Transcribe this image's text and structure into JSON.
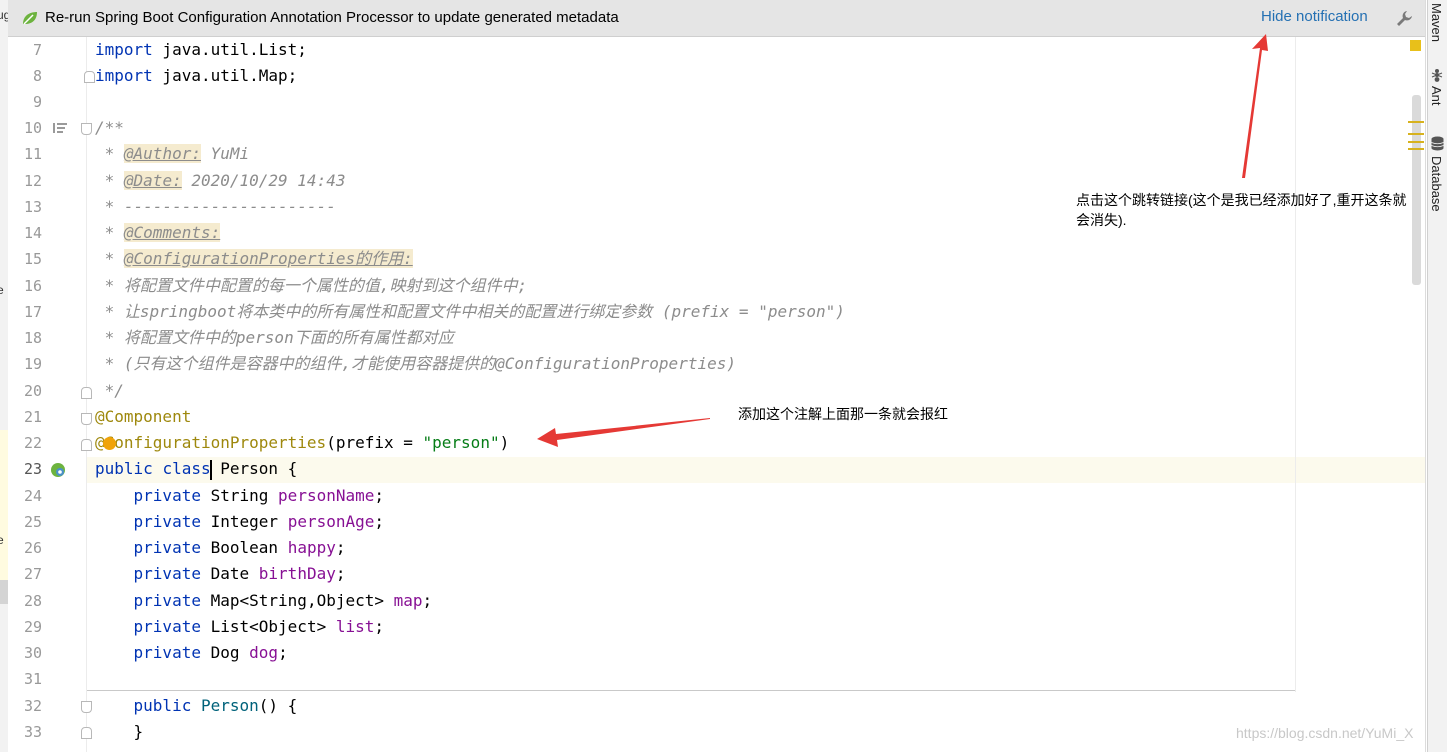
{
  "notification": {
    "message": "Re-run Spring Boot Configuration Annotation Processor to update generated metadata",
    "hide_link": "Hide notification"
  },
  "tool_windows": [
    "Maven",
    "Ant",
    "Database"
  ],
  "left_stub_chars": [
    "ug",
    "e",
    "e"
  ],
  "line_numbers": [
    "7",
    "8",
    "9",
    "10",
    "11",
    "12",
    "13",
    "14",
    "15",
    "16",
    "17",
    "18",
    "19",
    "20",
    "21",
    "22",
    "23",
    "24",
    "25",
    "26",
    "27",
    "28",
    "29",
    "30",
    "31",
    "32",
    "33"
  ],
  "code": {
    "l7": {
      "kw": "import",
      "rest": " java.util.List;"
    },
    "l8": {
      "kw": "import",
      "rest": " java.util.Map;"
    },
    "l10": "/**",
    "l11": {
      "pre": " * ",
      "tag": "@Author:",
      "post": " YuMi"
    },
    "l12": {
      "pre": " * ",
      "tag": "@Date:",
      "post": " 2020/10/29 14:43"
    },
    "l13": " * ----------------------",
    "l14": {
      "pre": " * ",
      "tag": "@Comments:"
    },
    "l15": {
      "pre": " * ",
      "tag": "@ConfigurationProperties的作用:"
    },
    "l16": " * 将配置文件中配置的每一个属性的值,映射到这个组件中;",
    "l17": " * 让springboot将本类中的所有属性和配置文件中相关的配置进行绑定参数 (prefix = \"person\")",
    "l18": " * 将配置文件中的person下面的所有属性都对应",
    "l19": " * (只有这个组件是容器中的组件,才能使用容器提供的@ConfigurationProperties)",
    "l20": " */",
    "l21": "@Component",
    "l22": {
      "ann": "@ConfigurationProperties",
      "open": "(prefix = ",
      "str": "\"person\"",
      "close": ")"
    },
    "l23": {
      "kw1": "public",
      "kw2": "clas",
      "kw2b": "s",
      "rest": " Person {"
    },
    "fields": [
      {
        "type": "String",
        "name": "personName"
      },
      {
        "type": "Integer",
        "name": "personAge"
      },
      {
        "type": "Boolean",
        "name": "happy"
      },
      {
        "type": "Date",
        "name": "birthDay"
      },
      {
        "type": "Map<String,Object>",
        "name": "map"
      },
      {
        "type": "List<Object>",
        "name": "list"
      },
      {
        "type": "Dog",
        "name": "dog"
      }
    ],
    "private_kw": "private",
    "semicolon": ";",
    "l32": {
      "kw": "public",
      "name": "Person",
      "rest": "() {"
    },
    "l33": "}"
  },
  "annotations": {
    "hide_note_line1": "点击这个跳转链接(这个是我已经添加好了,重开这条就",
    "hide_note_line2": "会消失).",
    "component_note": "添加这个注解上面那一条就会报红"
  },
  "watermark": "https://blog.csdn.net/YuMi_X",
  "colors": {
    "keyword": "#0033b3",
    "annotation": "#9e880d",
    "string": "#067d17",
    "field": "#871094",
    "comment": "#8c8c8c",
    "link": "#2470b3",
    "arrow": "#e53935"
  }
}
